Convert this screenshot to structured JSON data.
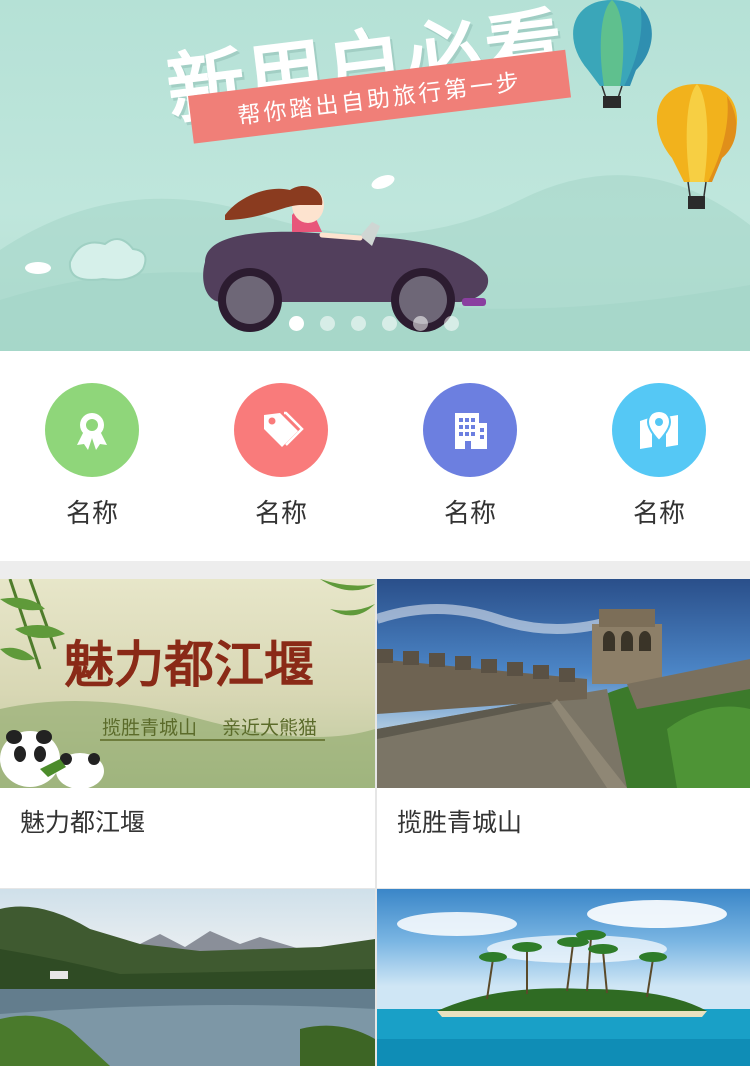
{
  "banner": {
    "title": "新用户必看",
    "subtitle": "帮你踏出自助旅行第一步",
    "slide_count": 6,
    "active_slide": 1
  },
  "categories": [
    {
      "label": "名称",
      "icon": "award-icon",
      "color": "#8fd67a"
    },
    {
      "label": "名称",
      "icon": "tag-icon",
      "color": "#f97b7b"
    },
    {
      "label": "名称",
      "icon": "building-icon",
      "color": "#6c7fe0"
    },
    {
      "label": "名称",
      "icon": "map-pin-icon",
      "color": "#55c8f5"
    }
  ],
  "cards": [
    {
      "title": "魅力都江堰",
      "image_headline": "魅力都江堰",
      "image_tagline_a": "揽胜青城山",
      "image_tagline_b": "亲近大熊猫"
    },
    {
      "title": "揽胜青城山"
    },
    {
      "title": ""
    },
    {
      "title": ""
    }
  ]
}
